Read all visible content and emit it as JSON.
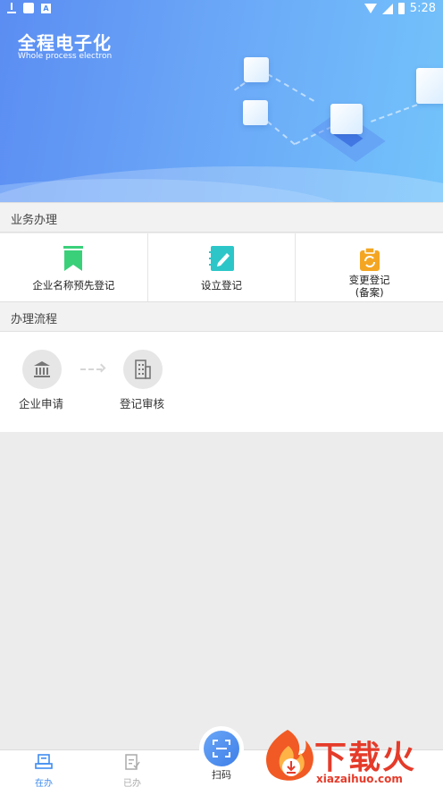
{
  "status_bar": {
    "time": "5:28"
  },
  "banner": {
    "title": "全程电子化",
    "subtitle": "Whole process electron"
  },
  "business": {
    "section_title": "业务办理",
    "items": [
      {
        "label": "企业名称预先登记",
        "icon": "bookmark-icon",
        "color": "#3ad07a"
      },
      {
        "label": "设立登记",
        "icon": "edit-notebook-icon",
        "color": "#2cc6c8"
      },
      {
        "label": "变更登记",
        "label_line2": "(备案)",
        "icon": "clipboard-refresh-icon",
        "color": "#f4a623"
      }
    ]
  },
  "process": {
    "section_title": "办理流程",
    "steps": [
      {
        "label": "企业申请",
        "icon": "bank-building-icon"
      },
      {
        "label": "登记审核",
        "icon": "office-building-icon"
      }
    ]
  },
  "tabbar": {
    "tabs": [
      {
        "label": "在办",
        "active": true
      },
      {
        "label": "已办",
        "active": false
      }
    ],
    "scan_label": "扫码",
    "active_color": "#3f8cf0",
    "inactive_color": "#aaaaaa"
  },
  "watermark": {
    "text": "下载火",
    "url": "xiazaihuo.com"
  }
}
